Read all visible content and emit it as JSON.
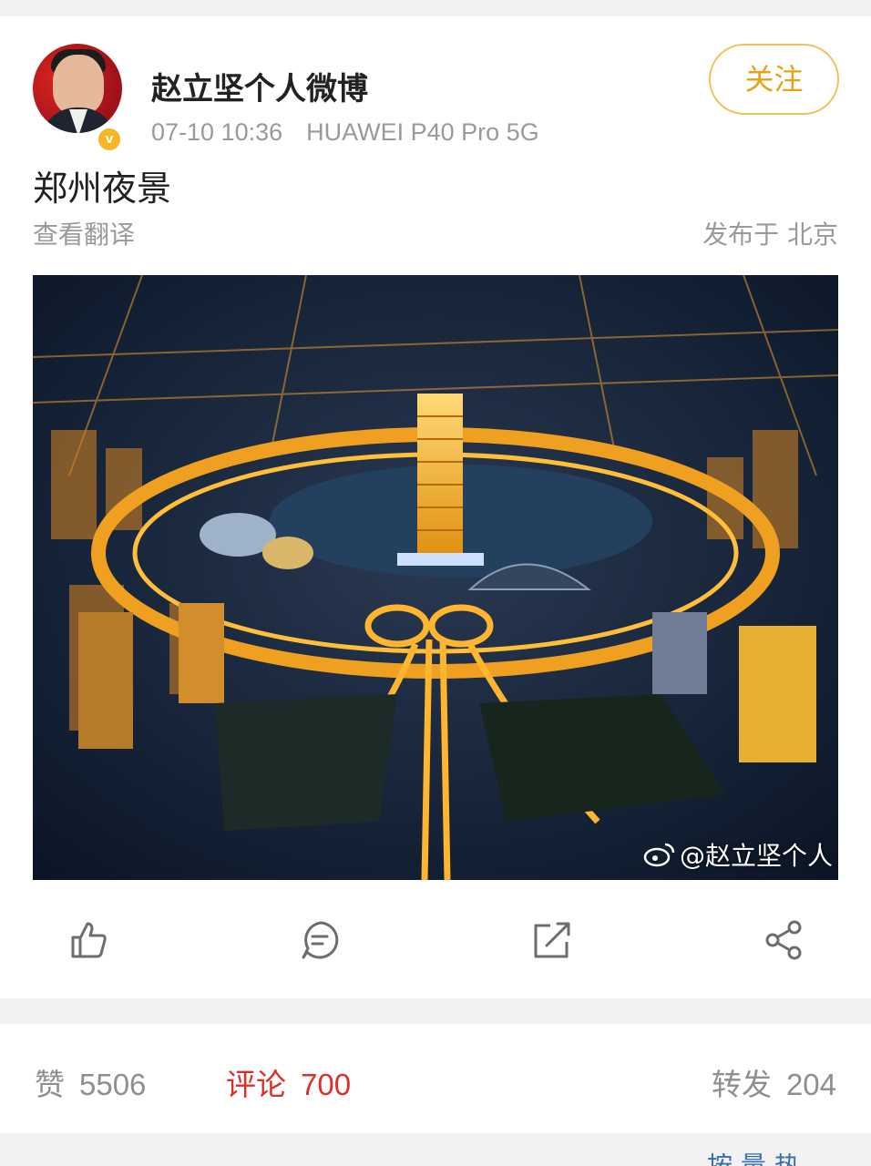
{
  "post": {
    "username": "赵立坚个人微博",
    "date": "07-10 10:36",
    "device": "HUAWEI P40 Pro 5G",
    "follow_label": "关注",
    "verified_badge": "v",
    "text": "郑州夜景",
    "translate_label": "查看翻译",
    "location": "发布于 北京",
    "image_watermark": "@赵立坚个人",
    "accent_color": "#e8a21a"
  },
  "actions": {
    "icons": [
      "thumbs-up-icon",
      "comment-icon",
      "repost-icon",
      "share-icon"
    ]
  },
  "stats": {
    "likes_label": "赞",
    "likes": "5506",
    "comments_label": "评论",
    "comments": "700",
    "reposts_label": "转发",
    "reposts": "204",
    "active_color": "#d9312a"
  },
  "peek_text": "按 量 热"
}
